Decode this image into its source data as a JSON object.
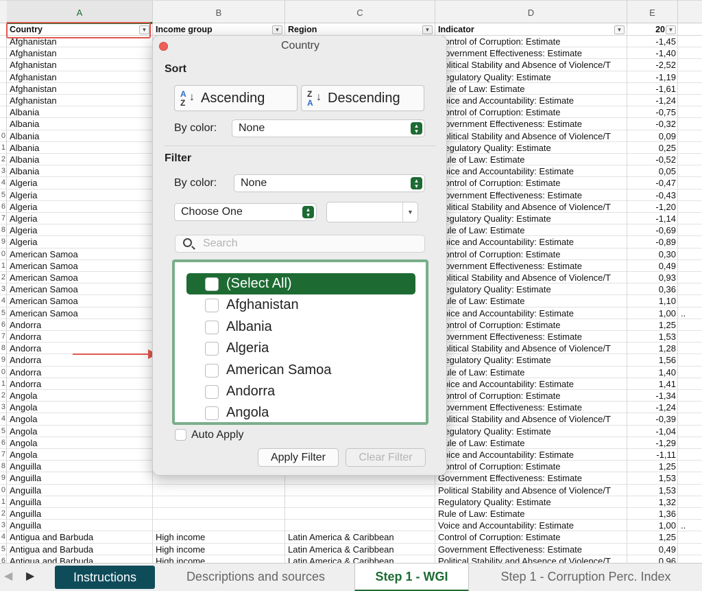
{
  "sheet": {
    "columns": [
      "A",
      "B",
      "C",
      "D",
      "E"
    ],
    "headers": {
      "a": "Country",
      "b": "Income group",
      "c": "Region",
      "d": "Indicator",
      "e": "20"
    },
    "filter_glyph": "▼",
    "rows": [
      {
        "n": "",
        "a": "Afghanistan",
        "b": "",
        "c": "",
        "d": "Control of Corruption: Estimate",
        "e": "-1,45",
        "f": ""
      },
      {
        "n": "",
        "a": "Afghanistan",
        "b": "",
        "c": "",
        "d": "Government Effectiveness: Estimate",
        "e": "-1,40",
        "f": ""
      },
      {
        "n": "",
        "a": "Afghanistan",
        "b": "",
        "c": "",
        "d": "Political Stability and Absence of Violence/T",
        "e": "-2,52",
        "f": ""
      },
      {
        "n": "",
        "a": "Afghanistan",
        "b": "",
        "c": "",
        "d": "Regulatory Quality: Estimate",
        "e": "-1,19",
        "f": ""
      },
      {
        "n": "",
        "a": "Afghanistan",
        "b": "",
        "c": "",
        "d": "Rule of Law: Estimate",
        "e": "-1,61",
        "f": ""
      },
      {
        "n": "",
        "a": "Afghanistan",
        "b": "",
        "c": "",
        "d": "Voice and Accountability: Estimate",
        "e": "-1,24",
        "f": ""
      },
      {
        "n": "",
        "a": "Albania",
        "b": "",
        "c": "",
        "d": "Control of Corruption: Estimate",
        "e": "-0,75",
        "f": ""
      },
      {
        "n": "",
        "a": "Albania",
        "b": "",
        "c": "",
        "d": "Government Effectiveness: Estimate",
        "e": "-0,32",
        "f": ""
      },
      {
        "n": "0",
        "a": "Albania",
        "b": "",
        "c": "",
        "d": "Political Stability and Absence of Violence/T",
        "e": "0,09",
        "f": ""
      },
      {
        "n": "1",
        "a": "Albania",
        "b": "",
        "c": "",
        "d": "Regulatory Quality: Estimate",
        "e": "0,25",
        "f": ""
      },
      {
        "n": "2",
        "a": "Albania",
        "b": "",
        "c": "",
        "d": "Rule of Law: Estimate",
        "e": "-0,52",
        "f": ""
      },
      {
        "n": "3",
        "a": "Albania",
        "b": "",
        "c": "",
        "d": "Voice and Accountability: Estimate",
        "e": "0,05",
        "f": ""
      },
      {
        "n": "4",
        "a": "Algeria",
        "b": "",
        "c": "",
        "d": "Control of Corruption: Estimate",
        "e": "-0,47",
        "f": ""
      },
      {
        "n": "5",
        "a": "Algeria",
        "b": "",
        "c": "",
        "d": "Government Effectiveness: Estimate",
        "e": "-0,43",
        "f": ""
      },
      {
        "n": "6",
        "a": "Algeria",
        "b": "",
        "c": "",
        "d": "Political Stability and Absence of Violence/T",
        "e": "-1,20",
        "f": ""
      },
      {
        "n": "7",
        "a": "Algeria",
        "b": "",
        "c": "",
        "d": "Regulatory Quality: Estimate",
        "e": "-1,14",
        "f": ""
      },
      {
        "n": "8",
        "a": "Algeria",
        "b": "",
        "c": "",
        "d": "Rule of Law: Estimate",
        "e": "-0,69",
        "f": ""
      },
      {
        "n": "9",
        "a": "Algeria",
        "b": "",
        "c": "",
        "d": "Voice and Accountability: Estimate",
        "e": "-0,89",
        "f": ""
      },
      {
        "n": "0",
        "a": "American Samoa",
        "b": "",
        "c": "",
        "d": "Control of Corruption: Estimate",
        "e": "0,30",
        "f": ""
      },
      {
        "n": "1",
        "a": "American Samoa",
        "b": "",
        "c": "",
        "d": "Government Effectiveness: Estimate",
        "e": "0,49",
        "f": ""
      },
      {
        "n": "2",
        "a": "American Samoa",
        "b": "",
        "c": "",
        "d": "Political Stability and Absence of Violence/T",
        "e": "0,93",
        "f": ""
      },
      {
        "n": "3",
        "a": "American Samoa",
        "b": "",
        "c": "",
        "d": "Regulatory Quality: Estimate",
        "e": "0,36",
        "f": ""
      },
      {
        "n": "4",
        "a": "American Samoa",
        "b": "",
        "c": "",
        "d": "Rule of Law: Estimate",
        "e": "1,10",
        "f": ""
      },
      {
        "n": "5",
        "a": "American Samoa",
        "b": "",
        "c": "",
        "d": "Voice and Accountability: Estimate",
        "e": "1,00",
        "f": ".."
      },
      {
        "n": "6",
        "a": "Andorra",
        "b": "",
        "c": "",
        "d": "Control of Corruption: Estimate",
        "e": "1,25",
        "f": ""
      },
      {
        "n": "7",
        "a": "Andorra",
        "b": "",
        "c": "",
        "d": "Government Effectiveness: Estimate",
        "e": "1,53",
        "f": ""
      },
      {
        "n": "8",
        "a": "Andorra",
        "b": "",
        "c": "",
        "d": "Political Stability and Absence of Violence/T",
        "e": "1,28",
        "f": ""
      },
      {
        "n": "9",
        "a": "Andorra",
        "b": "",
        "c": "",
        "d": "Regulatory Quality: Estimate",
        "e": "1,56",
        "f": ""
      },
      {
        "n": "0",
        "a": "Andorra",
        "b": "",
        "c": "",
        "d": "Rule of Law: Estimate",
        "e": "1,40",
        "f": ""
      },
      {
        "n": "1",
        "a": "Andorra",
        "b": "",
        "c": "",
        "d": "Voice and Accountability: Estimate",
        "e": "1,41",
        "f": ""
      },
      {
        "n": "2",
        "a": "Angola",
        "b": "",
        "c": "",
        "d": "Control of Corruption: Estimate",
        "e": "-1,34",
        "f": ""
      },
      {
        "n": "3",
        "a": "Angola",
        "b": "",
        "c": "",
        "d": "Government Effectiveness: Estimate",
        "e": "-1,24",
        "f": ""
      },
      {
        "n": "4",
        "a": "Angola",
        "b": "",
        "c": "",
        "d": "Political Stability and Absence of Violence/T",
        "e": "-0,39",
        "f": ""
      },
      {
        "n": "5",
        "a": "Angola",
        "b": "",
        "c": "",
        "d": "Regulatory Quality: Estimate",
        "e": "-1,04",
        "f": ""
      },
      {
        "n": "6",
        "a": "Angola",
        "b": "",
        "c": "",
        "d": "Rule of Law: Estimate",
        "e": "-1,29",
        "f": ""
      },
      {
        "n": "7",
        "a": "Angola",
        "b": "",
        "c": "",
        "d": "Voice and Accountability: Estimate",
        "e": "-1,11",
        "f": ""
      },
      {
        "n": "8",
        "a": "Anguilla",
        "b": "",
        "c": "",
        "d": "Control of Corruption: Estimate",
        "e": "1,25",
        "f": ""
      },
      {
        "n": "9",
        "a": "Anguilla",
        "b": "",
        "c": "",
        "d": "Government Effectiveness: Estimate",
        "e": "1,53",
        "f": ""
      },
      {
        "n": "0",
        "a": "Anguilla",
        "b": "",
        "c": "",
        "d": "Political Stability and Absence of Violence/T",
        "e": "1,53",
        "f": ""
      },
      {
        "n": "1",
        "a": "Anguilla",
        "b": "",
        "c": "",
        "d": "Regulatory Quality: Estimate",
        "e": "1,32",
        "f": ""
      },
      {
        "n": "2",
        "a": "Anguilla",
        "b": "",
        "c": "",
        "d": "Rule of Law: Estimate",
        "e": "1,36",
        "f": ""
      },
      {
        "n": "3",
        "a": "Anguilla",
        "b": "",
        "c": "",
        "d": "Voice and Accountability: Estimate",
        "e": "1,00",
        "f": ".."
      },
      {
        "n": "4",
        "a": "Antigua and Barbuda",
        "b": "High income",
        "c": "Latin America & Caribbean",
        "d": "Control of Corruption: Estimate",
        "e": "1,25",
        "f": ""
      },
      {
        "n": "5",
        "a": "Antigua and Barbuda",
        "b": "High income",
        "c": "Latin America & Caribbean",
        "d": "Government Effectiveness: Estimate",
        "e": "0,49",
        "f": ""
      },
      {
        "n": "6",
        "a": "Antigua and Barbuda",
        "b": "High income",
        "c": "Latin America & Caribbean",
        "d": "Political Stability and Absence of Violence/T",
        "e": "0,96",
        "f": ""
      }
    ]
  },
  "popover": {
    "title": "Country",
    "sort_heading": "Sort",
    "ascending_label": "Ascending",
    "descending_label": "Descending",
    "sort_by_color_label": "By color:",
    "sort_color_value": "None",
    "filter_heading": "Filter",
    "filter_by_color_label": "By color:",
    "filter_color_value": "None",
    "condition_value": "Choose One",
    "condition_text": "",
    "search_placeholder": "Search",
    "list_items": [
      {
        "label": "(Select All)",
        "selected": true
      },
      {
        "label": "Afghanistan",
        "selected": false
      },
      {
        "label": "Albania",
        "selected": false
      },
      {
        "label": "Algeria",
        "selected": false
      },
      {
        "label": "American Samoa",
        "selected": false
      },
      {
        "label": "Andorra",
        "selected": false
      },
      {
        "label": "Angola",
        "selected": false
      }
    ],
    "auto_apply_label": "Auto Apply",
    "apply_label": "Apply Filter",
    "clear_label": "Clear Filter"
  },
  "tabs": {
    "prev_icon": "◀",
    "next_icon": "▶",
    "items": [
      "Instructions",
      "Descriptions and sources",
      "Step 1 - WGI",
      "Step 1 - Corruption Perc. Index"
    ],
    "active": "Step 1 - WGI"
  },
  "colors": {
    "accent_green": "#1d6b33",
    "instructions_tab": "#0f4c5a",
    "highlight_red": "#e2574c",
    "list_border": "#7aae8a"
  }
}
